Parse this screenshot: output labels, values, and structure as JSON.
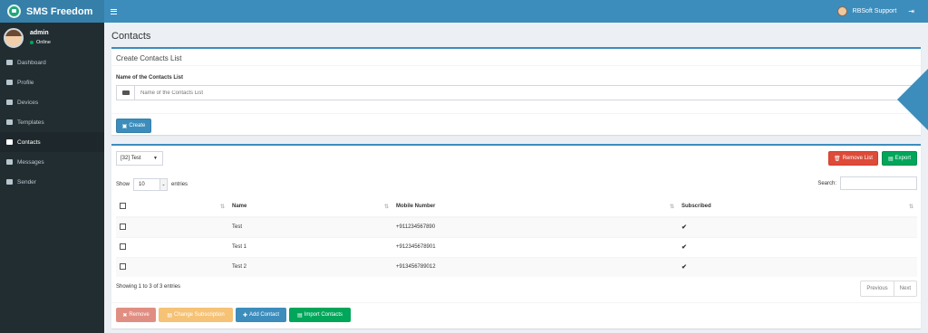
{
  "app": {
    "brand": "SMS Freedom"
  },
  "topbar": {
    "user": "RBSoft Support"
  },
  "sidebar": {
    "user": {
      "name": "admin",
      "status": "Online"
    },
    "items": [
      {
        "label": "Dashboard",
        "icon": "dashboard-icon"
      },
      {
        "label": "Profile",
        "icon": "user-icon"
      },
      {
        "label": "Devices",
        "icon": "android-icon"
      },
      {
        "label": "Templates",
        "icon": "file-icon"
      },
      {
        "label": "Contacts",
        "icon": "address-card-icon",
        "active": true
      },
      {
        "label": "Messages",
        "icon": "envelope-icon"
      },
      {
        "label": "Sender",
        "icon": "paper-plane-icon"
      }
    ]
  },
  "page": {
    "title": "Contacts"
  },
  "create_box": {
    "title": "Create Contacts List",
    "field_label": "Name of the Contacts List",
    "placeholder": "Name of the Contacts List",
    "create_label": "Create"
  },
  "list_box": {
    "selected_list": "[32] Test",
    "remove_list_label": "Remove List",
    "export_label": "Export",
    "show_label": "Show",
    "entries_value": "10",
    "entries_label": "entries",
    "search_label": "Search:",
    "columns": [
      "Name",
      "Mobile Number",
      "Subscribed"
    ],
    "rows": [
      {
        "name": "Test",
        "mobile": "+911234567890",
        "subscribed": "✔"
      },
      {
        "name": "Test 1",
        "mobile": "+912345678901",
        "subscribed": "✔"
      },
      {
        "name": "Test 2",
        "mobile": "+913456789012",
        "subscribed": "✔"
      }
    ],
    "showing": "Showing 1 to 3 of 3 entries",
    "previous_label": "Previous",
    "next_label": "Next",
    "remove_label": "Remove",
    "change_subscription_label": "Change Subscription",
    "add_contact_label": "Add Contact",
    "import_contacts_label": "Import Contacts"
  },
  "colors": {
    "primary": "#3c8dbc",
    "sidebar": "#222d32",
    "success": "#00a65a",
    "danger": "#dd4b39",
    "warning": "#f39c12"
  }
}
